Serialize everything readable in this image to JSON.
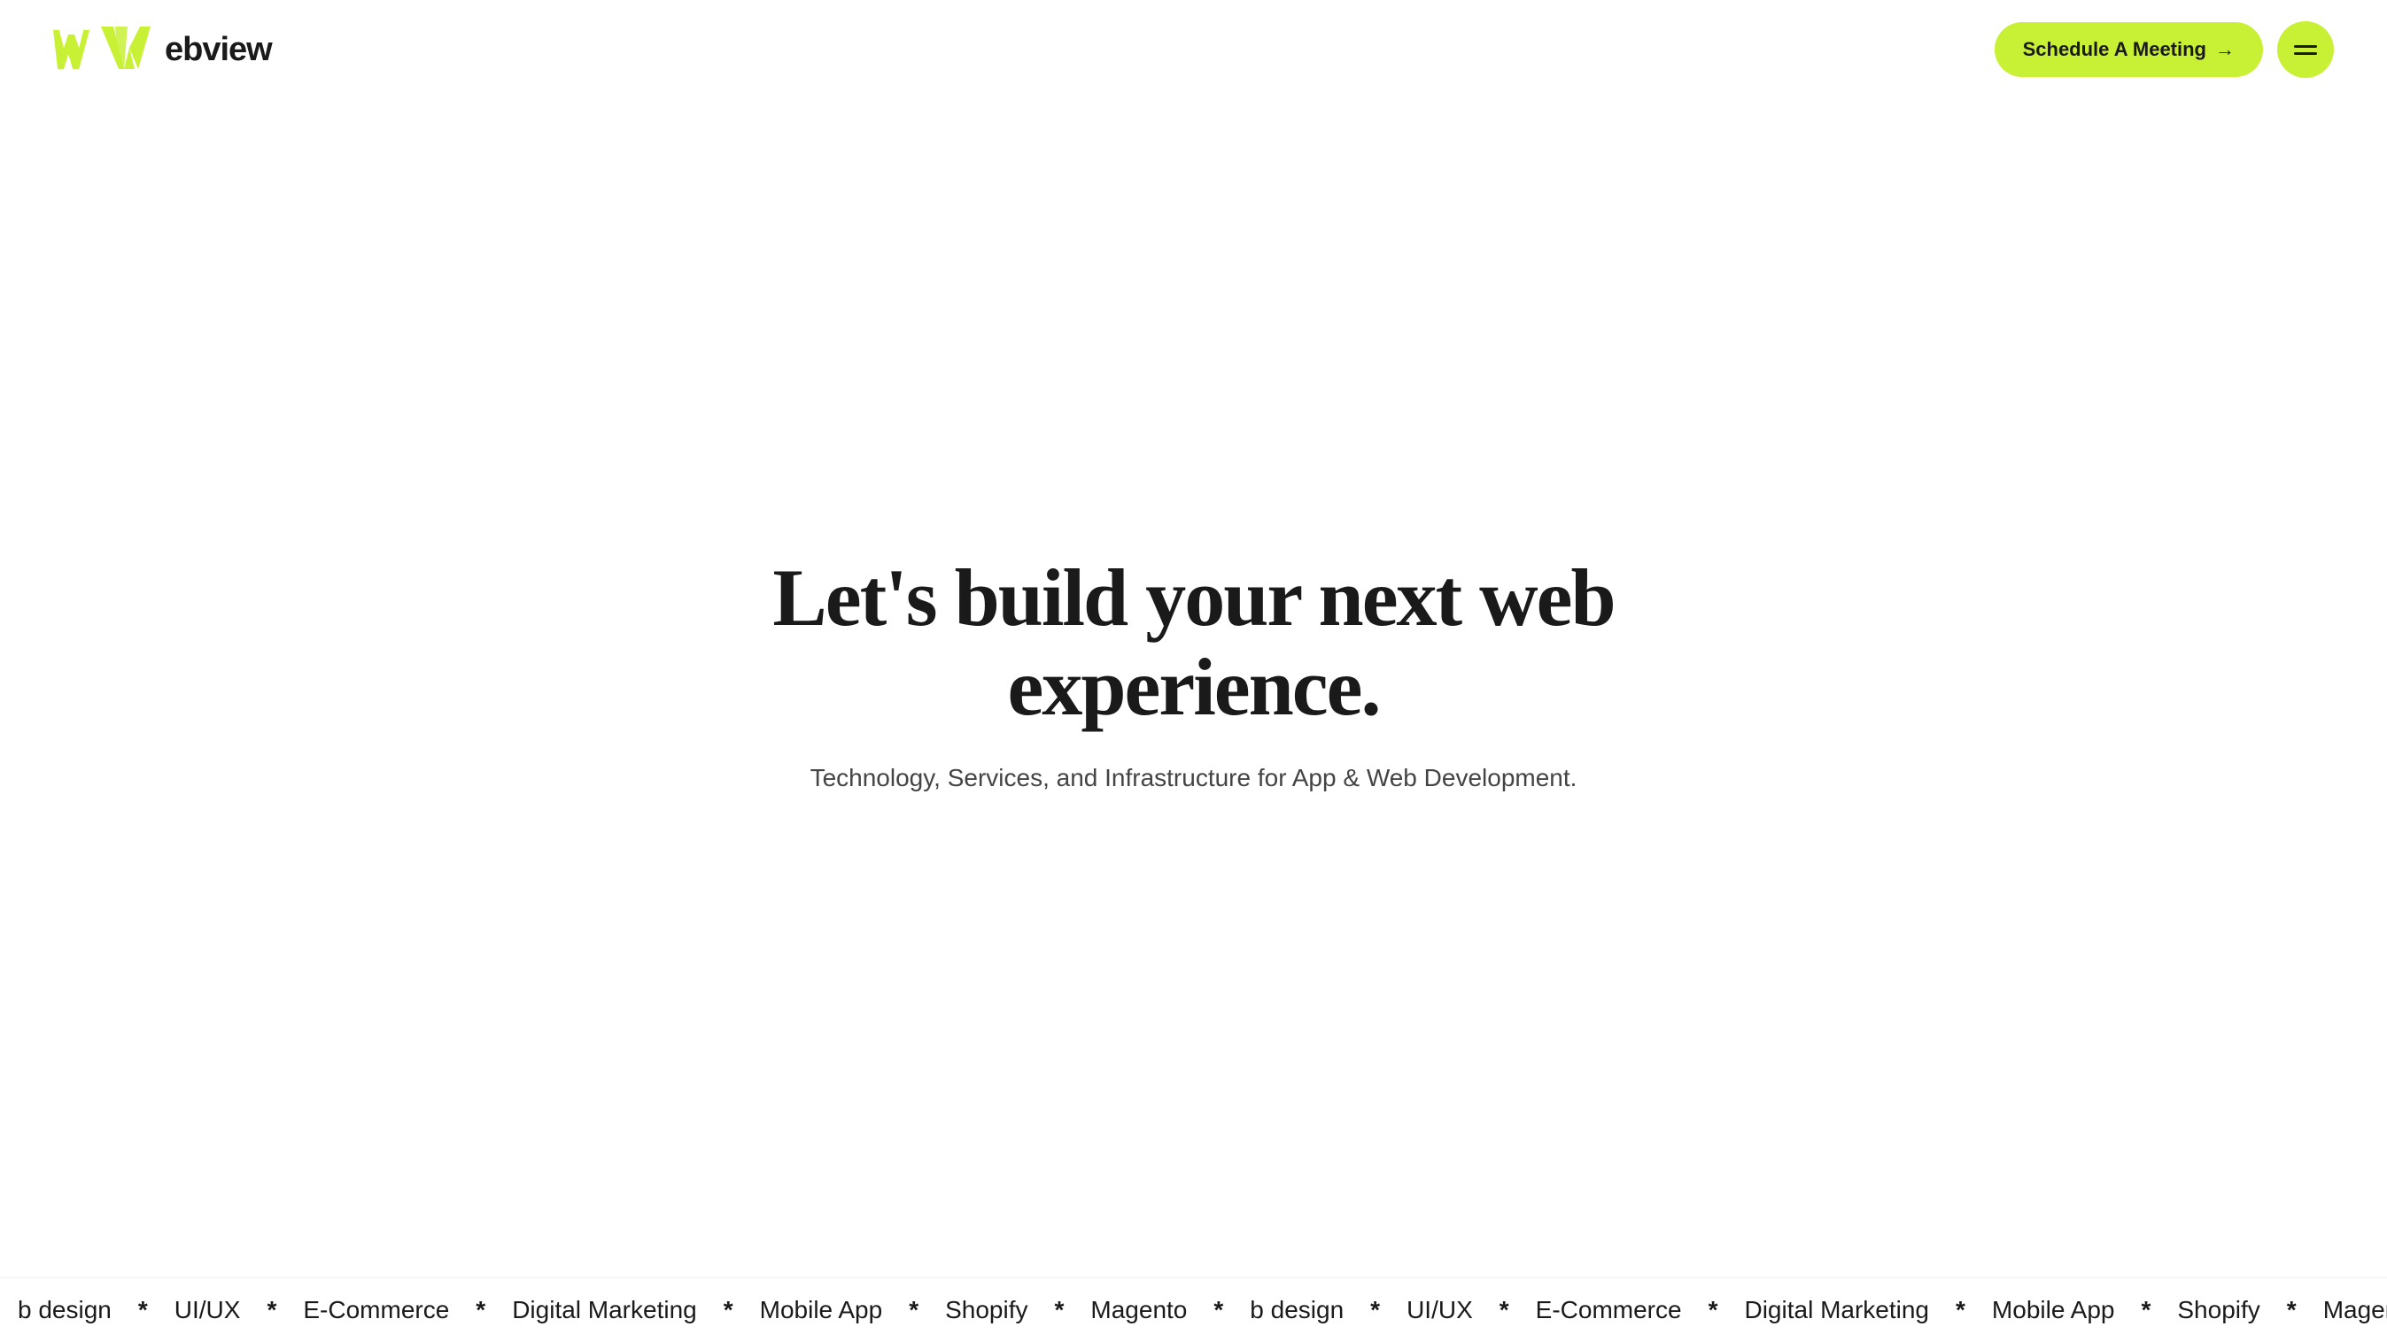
{
  "header": {
    "logo_text": "ebview",
    "schedule_btn_label": "Schedule A Meeting",
    "schedule_btn_arrow": "→",
    "menu_aria": "Menu"
  },
  "hero": {
    "title": "Let's build your next web experience.",
    "subtitle": "Technology, Services, and Infrastructure for App & Web Development."
  },
  "ticker": {
    "items": [
      "b design",
      "UI/UX",
      "E-Commerce",
      "Digital Marketing",
      "Mobile App",
      "Shopify",
      "Magento"
    ],
    "separator": "*"
  },
  "colors": {
    "accent": "#c8f135",
    "dark": "#1a1a1a",
    "text_secondary": "#444444"
  }
}
